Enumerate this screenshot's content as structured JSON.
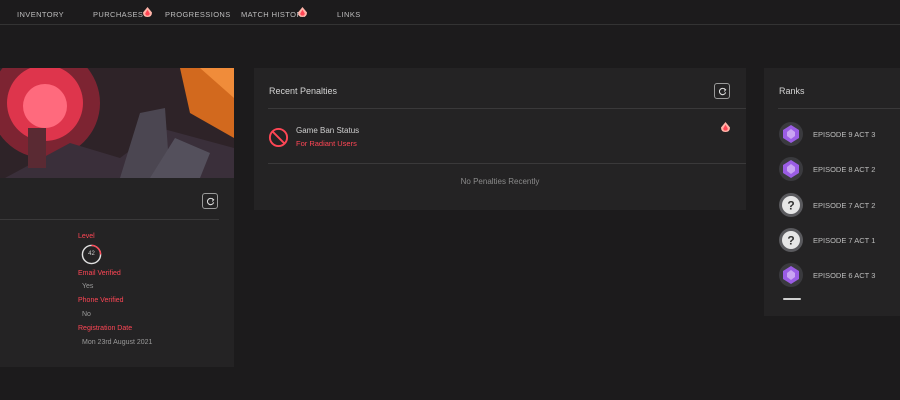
{
  "nav": {
    "items": [
      "INVENTORY",
      "PURCHASES",
      "PROGRESSIONS",
      "MATCH HISTORY",
      "LINKS"
    ]
  },
  "profile": {
    "fields": [
      {
        "label": "Level",
        "value": "42"
      },
      {
        "label": "Email Verified",
        "value": "Yes"
      },
      {
        "label": "Phone Verified",
        "value": "No"
      },
      {
        "label": "Registration Date",
        "value": "Mon 23rd August 2021"
      }
    ]
  },
  "penalties": {
    "title": "Recent Penalties",
    "ban": {
      "title": "Game Ban Status",
      "subtitle": "For Radiant Users"
    },
    "empty_text": "No Penalties Recently"
  },
  "ranks": {
    "title": "Ranks",
    "items": [
      {
        "label": "EPISODE 9 ACT 3",
        "icon": "ascendant-rank-icon"
      },
      {
        "label": "EPISODE 8 ACT 2",
        "icon": "ascendant-rank-icon"
      },
      {
        "label": "EPISODE 7 ACT 2",
        "icon": "unranked-question-icon"
      },
      {
        "label": "EPISODE 7 ACT 1",
        "icon": "unranked-question-icon"
      },
      {
        "label": "EPISODE 6 ACT 3",
        "icon": "ascendant-rank-icon"
      }
    ]
  },
  "colors": {
    "accent": "#ff4655",
    "background": "#1c1b1c",
    "panel": "#242324",
    "rank_purple": "#9b5de5"
  }
}
